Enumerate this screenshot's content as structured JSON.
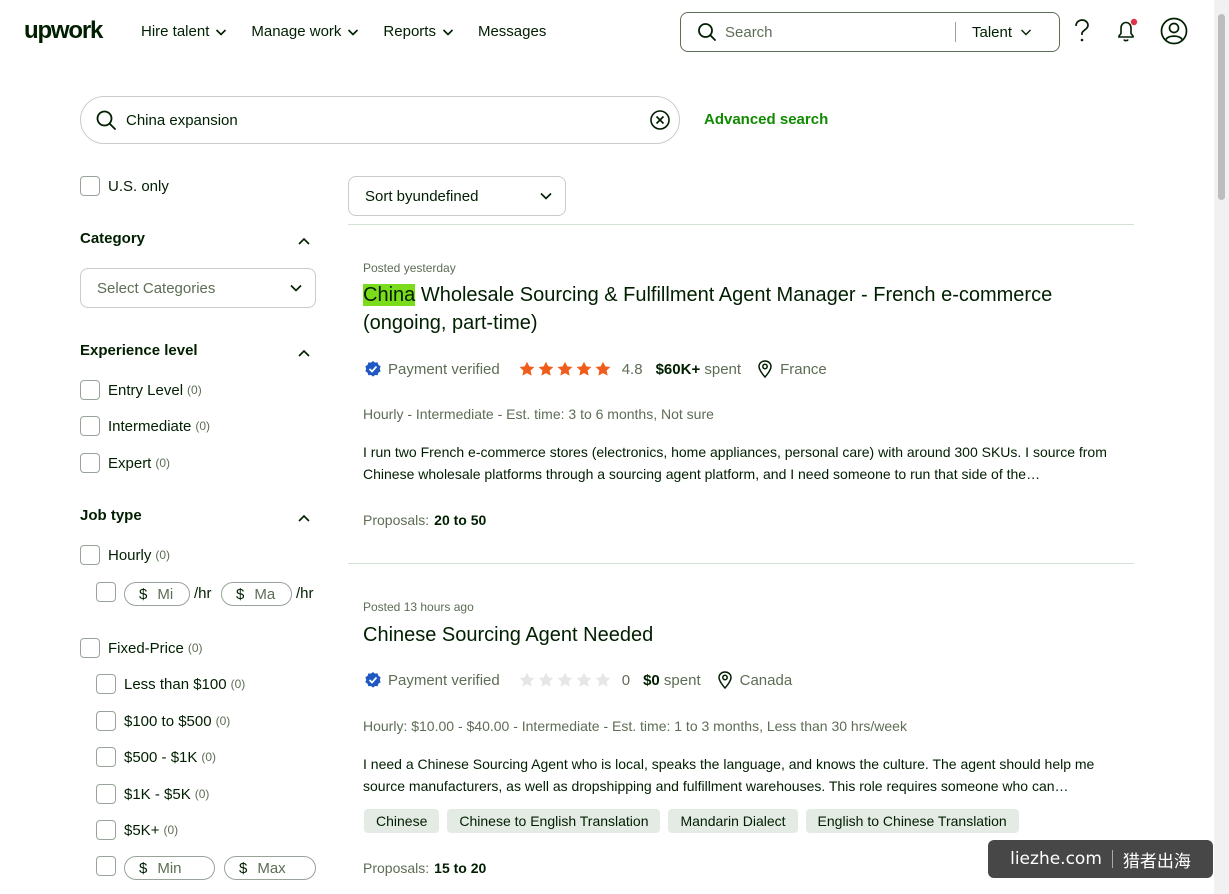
{
  "header": {
    "logo": "upwork",
    "nav": [
      "Hire talent",
      "Manage work",
      "Reports",
      "Messages"
    ],
    "search_placeholder": "Search",
    "search_scope": "Talent"
  },
  "search": {
    "query": "China expansion",
    "advanced_label": "Advanced search"
  },
  "filters": {
    "us_only": "U.S. only",
    "category": {
      "title": "Category",
      "select_label": "Select Categories"
    },
    "experience": {
      "title": "Experience level",
      "options": [
        {
          "label": "Entry Level",
          "count": "(0)"
        },
        {
          "label": "Intermediate",
          "count": "(0)"
        },
        {
          "label": "Expert",
          "count": "(0)"
        }
      ]
    },
    "job_type": {
      "title": "Job type",
      "hourly": {
        "label": "Hourly",
        "count": "(0)"
      },
      "hourly_min_placeholder": "Mi",
      "hourly_max_placeholder": "Ma",
      "per_hr": "/hr",
      "currency": "$",
      "fixed": {
        "label": "Fixed-Price",
        "count": "(0)"
      },
      "fixed_options": [
        {
          "label": "Less than $100",
          "count": "(0)"
        },
        {
          "label": "$100 to $500",
          "count": "(0)"
        },
        {
          "label": "$500 - $1K",
          "count": "(0)"
        },
        {
          "label": "$1K - $5K",
          "count": "(0)"
        },
        {
          "label": "$5K+",
          "count": "(0)"
        }
      ],
      "fixed_min_placeholder": "Min",
      "fixed_max_placeholder": "Max"
    }
  },
  "sort": {
    "label": "Sort byundefined"
  },
  "jobs": [
    {
      "posted": "Posted yesterday",
      "title_highlight": "China",
      "title_rest": " Wholesale Sourcing & Fulfillment Agent Manager - French e-commerce (ongoing, part-time)",
      "payment": "Payment verified",
      "rating": "4.8",
      "stars_filled": 5,
      "spent_amount": "$60K+",
      "spent_label": " spent",
      "location": "France",
      "info": "Hourly - Intermediate - Est. time: 3 to 6 months, Not sure",
      "description": "I run two French e-commerce stores (electronics, home appliances, personal care) with around 300 SKUs. I source from Chinese wholesale platforms through a sourcing agent platform, and I need someone to run that side of the…",
      "proposals_label": "Proposals:",
      "proposals": "20 to 50"
    },
    {
      "posted": "Posted 13 hours ago",
      "title": "Chinese Sourcing Agent Needed",
      "payment": "Payment verified",
      "rating": "0",
      "stars_filled": 0,
      "spent_amount": "$0",
      "spent_label": " spent",
      "location": "Canada",
      "info": "Hourly: $10.00 - $40.00 - Intermediate - Est. time: 1 to 3 months, Less than 30 hrs/week",
      "description": "I need a Chinese Sourcing Agent who is local, speaks the language, and knows the culture. The agent should help me source manufacturers, as well as dropshipping and fulfillment warehouses. This role requires someone who can…",
      "tags": [
        "Chinese",
        "Chinese to English Translation",
        "Mandarin Dialect",
        "English to Chinese Translation"
      ],
      "proposals_label": "Proposals:",
      "proposals": "15 to 20"
    }
  ],
  "watermark": {
    "left": "liezhe.com",
    "right": "猎者出海"
  },
  "colors": {
    "brand_green": "#108a00",
    "star_orange": "#f05c1b",
    "verified_blue": "#1f57c3",
    "highlight": "#7bdc1c"
  }
}
